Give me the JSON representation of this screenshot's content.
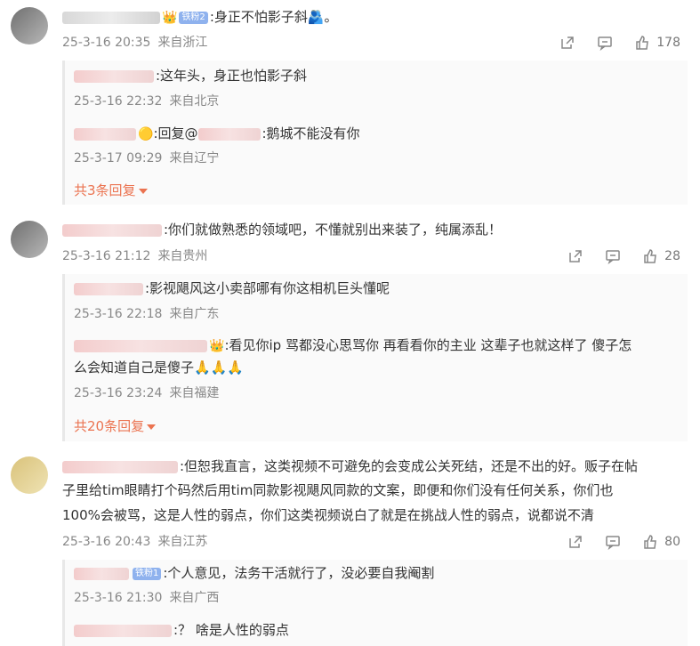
{
  "comments": [
    {
      "badge": "铁粉2",
      "text": ":身正不怕影子斜🫂。",
      "time": "25-3-16 20:35",
      "location": "来自浙江",
      "likes": "178",
      "replies": [
        {
          "text": ":这年头，身正也怕影子斜",
          "time": "25-3-16 22:32",
          "location": "来自北京"
        },
        {
          "prefix": ":回复@",
          "text": ":鹅城不能没有你",
          "time": "25-3-17 09:29",
          "location": "来自辽宁"
        }
      ],
      "more_label": "共3条回复"
    },
    {
      "text": ":你们就做熟悉的领域吧，不懂就别出来装了，纯属添乱！",
      "time": "25-3-16 21:12",
      "location": "来自贵州",
      "likes": "28",
      "replies": [
        {
          "text": ":影视飓风这小卖部哪有你这相机巨头懂呢",
          "time": "25-3-16 22:18",
          "location": "来自广东"
        },
        {
          "text_line1": ":看见你ip 骂都没心思骂你 再看看你的主业 这辈子也就这样了 傻子怎",
          "text_line2": "么会知道自己是傻子",
          "emoji": "🙏🙏🙏",
          "time": "25-3-16 23:24",
          "location": "来自福建"
        }
      ],
      "more_label": "共20条回复"
    },
    {
      "text_line1": ":但恕我直言，这类视频不可避免的会变成公关死结，还是不出的好。贩子在帖",
      "text_line2": "子里给tim眼睛打个码然后用tim同款影视飓风同款的文案，即便和你们没有任何关系，你们也",
      "text_line3": "100%会被骂，这是人性的弱点，你们这类视频说白了就是在挑战人性的弱点，说都说不清",
      "time": "25-3-16 20:43",
      "location": "来自江苏",
      "likes": "80",
      "replies": [
        {
          "badge": "铁粉1",
          "text": ":个人意见，法务干活就行了，没必要自我阉割",
          "time": "25-3-16 21:30",
          "location": "来自广西"
        },
        {
          "text": ":？ 啥是人性的弱点"
        }
      ]
    }
  ],
  "colors": {
    "accent": "#eb7350",
    "meta": "#888888",
    "badge": "#8fb2ee"
  }
}
